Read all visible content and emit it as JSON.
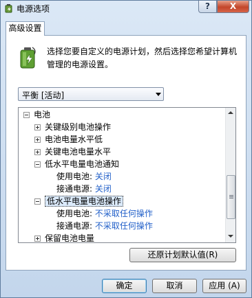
{
  "window": {
    "title": "电源选项",
    "help_label": "?",
    "close_label": "X"
  },
  "tab": {
    "label": "高级设置"
  },
  "description": "选择您要自定义的电源计划，然后选择您希望计算机管理的电源设置。",
  "plan_select": {
    "selected": "平衡 [活动]"
  },
  "tree": {
    "root": "电池",
    "item1": "关键级别电池操作",
    "item2": "电池电量水平低",
    "item3": "关键电池电量水平",
    "item4": "低水平电量电池通知",
    "item4_on_battery_label": "使用电池:",
    "item4_on_battery_value": "关闭",
    "item4_plugged_label": "接通电源:",
    "item4_plugged_value": "关闭",
    "item5": "低水平电量电池操作",
    "item5_on_battery_label": "使用电池:",
    "item5_on_battery_value": "不采取任何操作",
    "item5_plugged_label": "接通电源:",
    "item5_plugged_value": "不采取任何操作",
    "item6": "保留电池电量"
  },
  "buttons": {
    "restore": "还原计划默认值(R)",
    "ok": "确定",
    "cancel": "取消",
    "apply": "应用 (A)"
  },
  "colors": {
    "value_text": "#2260c9",
    "selection": "#dcebfc",
    "close_button": "#c3462a"
  },
  "icons": [
    "power-options-icon",
    "battery-icon",
    "combo-arrow-icon",
    "scroll-up-icon",
    "scroll-down-icon"
  ]
}
